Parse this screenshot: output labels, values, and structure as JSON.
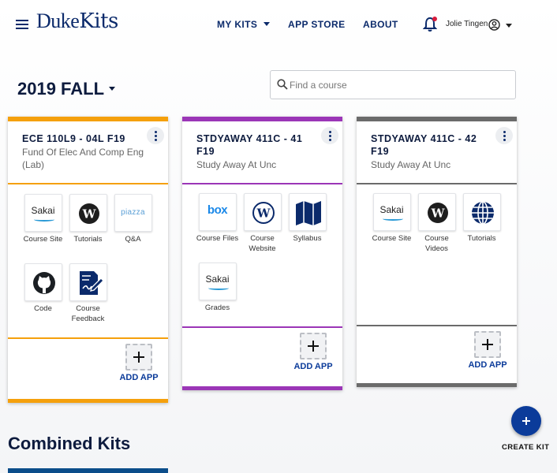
{
  "header": {
    "logo_left": "Duke",
    "logo_right": "Kits",
    "nav": {
      "my_kits": "MY KITS",
      "app_store": "APP STORE",
      "about": "ABOUT"
    },
    "user_name": "Jolie Tingen"
  },
  "term": {
    "label": "2019 FALL"
  },
  "search": {
    "placeholder": "Find a course"
  },
  "colors": {
    "brand": "#0b2a6b",
    "kit1": "#f5a00c",
    "kit2": "#9b36b7",
    "kit3": "#6b6b6b",
    "fab": "#0b3b9a"
  },
  "kits": [
    {
      "title": "ECE 110L9 - 04L F19",
      "subtitle": "Fund Of Elec And Comp Eng (Lab)",
      "apps": [
        {
          "label": "Course Site",
          "icon": "sakai-icon"
        },
        {
          "label": "Tutorials",
          "icon": "wordpress-icon"
        },
        {
          "label": "Q&A",
          "icon": "piazza-icon"
        },
        {
          "label": "Code",
          "icon": "github-icon"
        },
        {
          "label": "Course Feedback",
          "icon": "feedback-form-icon"
        }
      ],
      "add_label": "ADD APP"
    },
    {
      "title": "STDYAWAY 411C - 41 F19",
      "subtitle": "Study Away At Unc",
      "apps": [
        {
          "label": "Course Files",
          "icon": "box-icon"
        },
        {
          "label": "Course Website",
          "icon": "wordpress-icon"
        },
        {
          "label": "Syllabus",
          "icon": "map-icon"
        },
        {
          "label": "Grades",
          "icon": "sakai-icon"
        }
      ],
      "add_label": "ADD APP"
    },
    {
      "title": "STDYAWAY 411C - 42 F19",
      "subtitle": "Study Away At Unc",
      "apps": [
        {
          "label": "Course Site",
          "icon": "sakai-icon"
        },
        {
          "label": "Course Videos",
          "icon": "wordpress-icon"
        },
        {
          "label": "Tutorials",
          "icon": "globe-icon"
        }
      ],
      "add_label": "ADD APP"
    }
  ],
  "icon_text": {
    "sakai": "Sakai",
    "box": "box",
    "piazza": "piazza"
  },
  "combined": {
    "title": "Combined Kits"
  },
  "create_kit": {
    "label": "CREATE KIT"
  }
}
